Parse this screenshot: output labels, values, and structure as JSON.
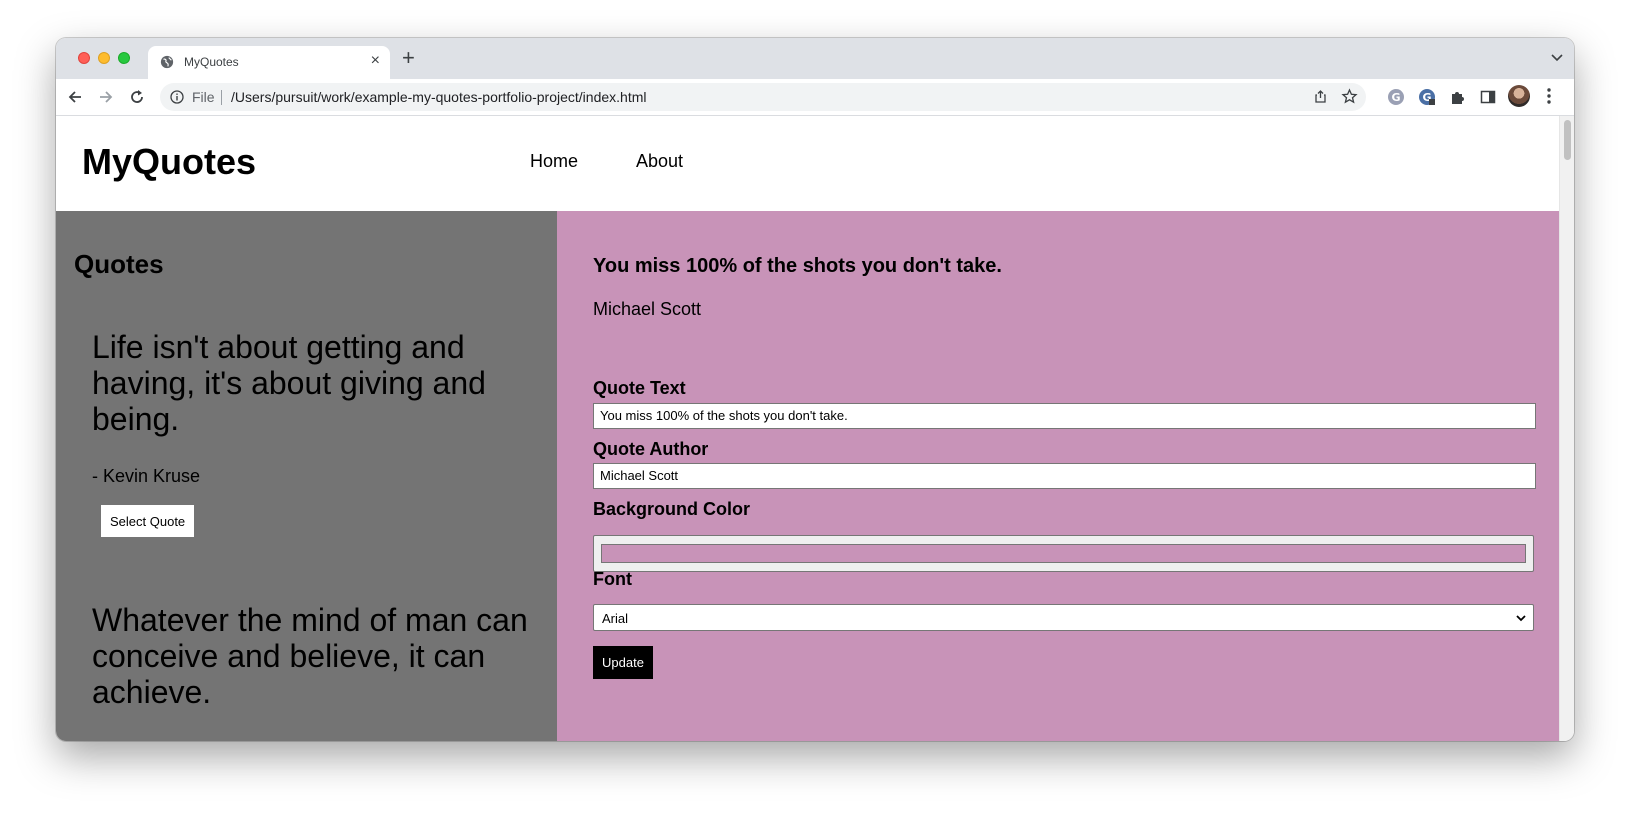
{
  "browser": {
    "tab_title": "MyQuotes",
    "new_tab": "+",
    "scheme_label": "File",
    "url": "/Users/pursuit/work/example-my-quotes-portfolio-project/index.html"
  },
  "site": {
    "brand": "MyQuotes",
    "nav": {
      "home": "Home",
      "about": "About"
    }
  },
  "quotes_panel": {
    "heading": "Quotes",
    "quotes": [
      {
        "text": "Life isn't about getting and having, it's about giving and being.",
        "author": "- Kevin Kruse",
        "button": "Select Quote"
      },
      {
        "text": "Whatever the mind of man can conceive and believe, it can achieve."
      }
    ]
  },
  "editor": {
    "current_quote": "You miss 100% of the shots you don't take.",
    "current_author": "Michael Scott",
    "quote_text_label": "Quote Text",
    "quote_text_value": "You miss 100% of the shots you don't take.",
    "quote_author_label": "Quote Author",
    "quote_author_value": "Michael Scott",
    "background_color_label": "Background Color",
    "background_color_value": "#c893b8",
    "font_label": "Font",
    "font_value": "Arial",
    "update_button": "Update"
  },
  "colors": {
    "left_panel_bg": "#747474",
    "right_panel_bg": "#c893b8"
  }
}
